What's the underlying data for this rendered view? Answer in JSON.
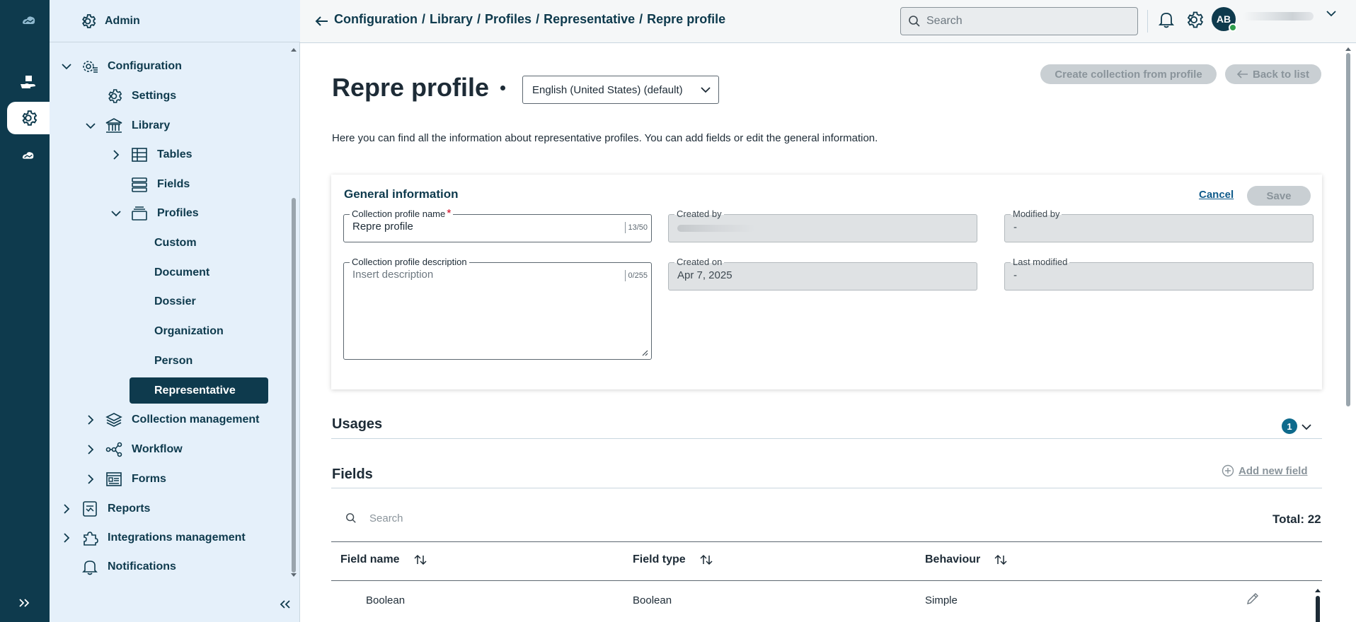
{
  "rail": {
    "items": [
      {
        "name": "cloud-logo-icon",
        "active": false
      },
      {
        "name": "hand-cube-icon",
        "active": false
      },
      {
        "name": "gear-icon",
        "active": true
      },
      {
        "name": "cloud-hand-icon",
        "active": false
      }
    ]
  },
  "sidebar": {
    "header_title": "Admin",
    "items": [
      {
        "label": "Configuration",
        "icon": "gear-list-icon",
        "chevron": "down"
      },
      {
        "label": "Settings",
        "icon": "gear-icon"
      },
      {
        "label": "Library",
        "icon": "library-icon",
        "chevron": "down"
      },
      {
        "label": "Tables",
        "icon": "table-icon",
        "chevron": "right"
      },
      {
        "label": "Fields",
        "icon": "fields-icon"
      },
      {
        "label": "Profiles",
        "icon": "profiles-icon",
        "chevron": "down"
      },
      {
        "label": "Custom"
      },
      {
        "label": "Document"
      },
      {
        "label": "Dossier"
      },
      {
        "label": "Organization"
      },
      {
        "label": "Person"
      },
      {
        "label": "Representative",
        "selected": true
      },
      {
        "label": "Collection management",
        "icon": "layers-icon",
        "chevron": "right"
      },
      {
        "label": "Workflow",
        "icon": "workflow-icon",
        "chevron": "right"
      },
      {
        "label": "Forms",
        "icon": "forms-icon",
        "chevron": "right"
      },
      {
        "label": "Reports",
        "icon": "reports-icon",
        "chevron": "right"
      },
      {
        "label": "Integrations management",
        "icon": "puzzle-icon",
        "chevron": "right"
      },
      {
        "label": "Notifications",
        "icon": "bell-icon"
      }
    ]
  },
  "topbar": {
    "breadcrumb": [
      "Configuration",
      "Library",
      "Profiles",
      "Representative",
      "Repre profile"
    ],
    "breadcrumb_sep": "/",
    "search_placeholder": "Search",
    "avatar_initials": "AB"
  },
  "page": {
    "title": "Repre profile",
    "language": "English (United States) (default)",
    "create_collection_label": "Create collection from profile",
    "back_label": "Back to list",
    "intro": "Here you can find all the information about representative profiles. You can add fields or edit the general information."
  },
  "general": {
    "title": "General information",
    "cancel_label": "Cancel",
    "save_label": "Save",
    "name_label": "Collection profile name",
    "name_required": "*",
    "name_value": "Repre profile",
    "name_counter": "13/50",
    "desc_label": "Collection profile description",
    "desc_placeholder": "Insert description",
    "desc_counter": "0/255",
    "created_by_label": "Created by",
    "modified_by_label": "Modified by",
    "modified_by_value": "-",
    "created_on_label": "Created on",
    "created_on_value": "Apr 7, 2025",
    "last_modified_label": "Last modified",
    "last_modified_value": "-"
  },
  "usages": {
    "title": "Usages",
    "count": "1"
  },
  "fields": {
    "title": "Fields",
    "add_label": "Add new field",
    "search_placeholder": "Search",
    "total": "Total: 22",
    "columns": [
      "Field name",
      "Field type",
      "Behaviour"
    ],
    "rows": [
      {
        "name": "Boolean",
        "type": "Boolean",
        "behaviour": "Simple"
      }
    ]
  },
  "colors": {
    "brand": "#0e3a4d",
    "sidebar_bg": "#e5f0fa",
    "disabled": "#c9cfd3",
    "badge": "#0e6a8c"
  }
}
